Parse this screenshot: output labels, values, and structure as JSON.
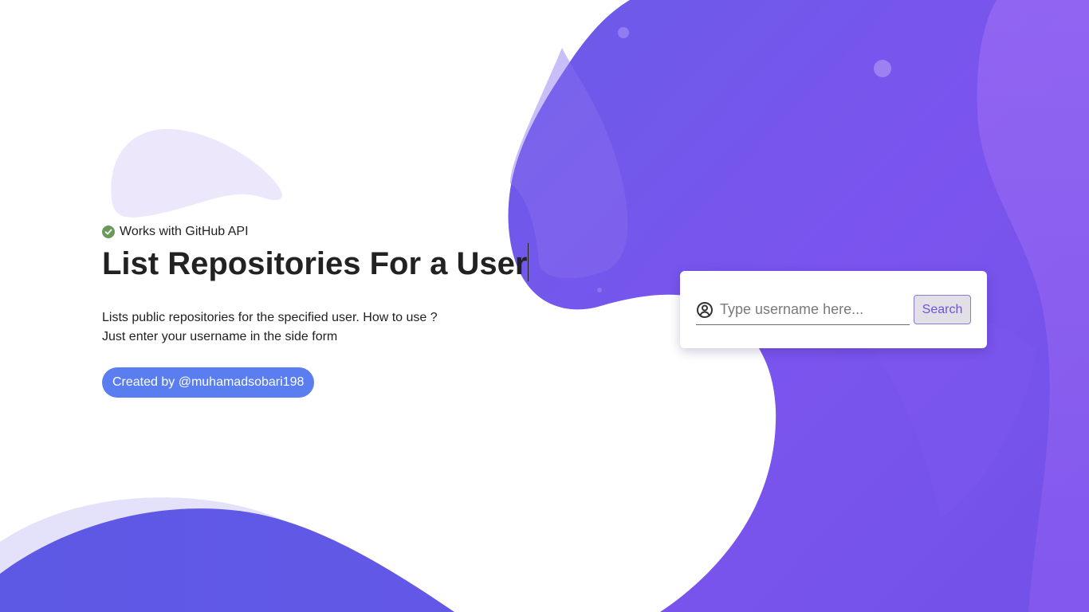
{
  "hero": {
    "badge_text": "Works with GitHub API",
    "title": "List Repositories For a User",
    "description_line1": "Lists public repositories for the specified user. How to use ?",
    "description_line2": "Just enter your username in the side form",
    "creator_label": "Created by @muhamadsobari198"
  },
  "search": {
    "placeholder": "Type username here...",
    "value": "",
    "button_label": "Search"
  },
  "icons": {
    "badge": "check-circle-icon",
    "field": "user-circle-icon"
  },
  "colors": {
    "accent_purple": "#7b54ee",
    "deep_indigo": "#5f59e6",
    "check_green": "#6a9a5a",
    "creator_blue": "#5a7df0",
    "button_text": "#6e52d8"
  }
}
